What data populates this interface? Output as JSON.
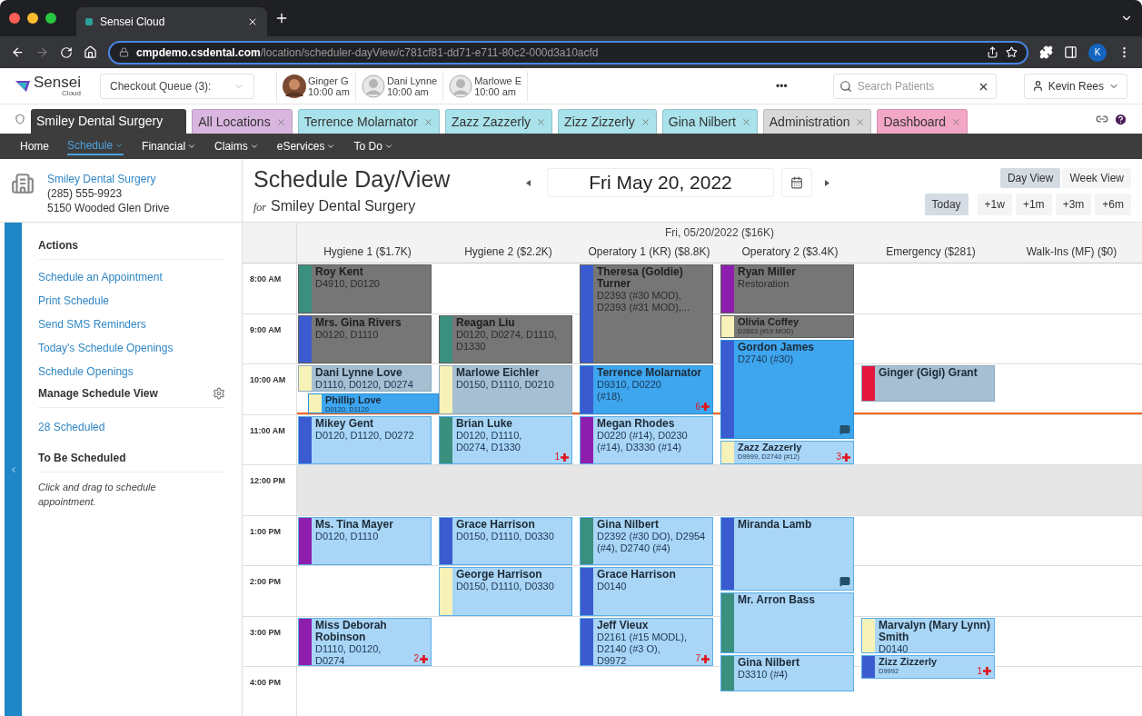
{
  "browser": {
    "tab_title": "Sensei Cloud",
    "url_host": "cmpdemo.csdental.com",
    "url_path": "/location/scheduler-dayView/c781cf81-dd71-e711-80c2-000d3a10acfd",
    "profile_initial": "K"
  },
  "app_header": {
    "logo": "Sensei",
    "logo_sub": "Cloud",
    "checkout_queue": "Checkout Queue (3):",
    "staff": [
      {
        "name": "Ginger G",
        "time": "10:00 am"
      },
      {
        "name": "Dani Lynne",
        "time": "10:00 am",
        "kind": "silhouette"
      },
      {
        "name": "Marlowe E",
        "time": "10:00 am",
        "kind": "silhouette"
      }
    ],
    "more": "•••",
    "search": {
      "placeholder": "Search Patients"
    },
    "user": "Kevin Rees"
  },
  "tabs": [
    {
      "label": "Smiley Dental Surgery",
      "color": "#3c3c3c",
      "closable": false,
      "selected": true
    },
    {
      "label": "All Locations",
      "color": "#d9b6e0",
      "closable": true,
      "selected": false
    },
    {
      "label": "Terrence Molarnator",
      "color": "#a9e2ea",
      "closable": true,
      "selected": false
    },
    {
      "label": "Zazz Zazzerly",
      "color": "#a9e2ea",
      "closable": true,
      "selected": false
    },
    {
      "label": "Zizz Zizzerly",
      "color": "#a9e2ea",
      "closable": true,
      "selected": false
    },
    {
      "label": "Gina Nilbert",
      "color": "#a9e2ea",
      "closable": true,
      "selected": false
    },
    {
      "label": "Administration",
      "color": "#d8d8d8",
      "closable": true,
      "selected": false
    },
    {
      "label": "Dashboard",
      "color": "#f3a7c6",
      "closable": true,
      "selected": false
    }
  ],
  "nav": [
    {
      "label": "Home",
      "dropdown": false,
      "selected": false
    },
    {
      "label": "Schedule",
      "dropdown": true,
      "selected": true
    },
    {
      "label": "Financial",
      "dropdown": true,
      "selected": false
    },
    {
      "label": "Claims",
      "dropdown": true,
      "selected": false
    },
    {
      "label": "eServices",
      "dropdown": true,
      "selected": false
    },
    {
      "label": "To Do",
      "dropdown": true,
      "selected": false
    }
  ],
  "sidebar": {
    "practice": {
      "name": "Smiley Dental Surgery",
      "phone": "(285) 555-9923",
      "address": "5150 Wooded Glen Drive"
    },
    "actions_title": "Actions",
    "actions": [
      "Schedule an Appointment",
      "Print Schedule",
      "Send SMS Reminders",
      "Today's Schedule Openings",
      "Schedule Openings"
    ],
    "manage_title": "Manage Schedule View",
    "scheduled_link": "28 Scheduled",
    "to_be_scheduled_title": "To Be Scheduled",
    "hint": "Click and drag to schedule appointment."
  },
  "schedule": {
    "title": "Schedule Day/View",
    "subtitle_prefix": "for",
    "subtitle": "Smiley Dental Surgery",
    "date": "Fri May 20, 2022",
    "view_buttons": [
      {
        "label": "Day View",
        "selected": true
      },
      {
        "label": "Week View",
        "selected": false
      }
    ],
    "jump_buttons": [
      {
        "label": "Today",
        "selected": true
      },
      {
        "label": "+1w",
        "selected": false
      },
      {
        "label": "+1m",
        "selected": false
      },
      {
        "label": "+3m",
        "selected": false
      },
      {
        "label": "+6m",
        "selected": false
      }
    ],
    "day_header": "Fri, 05/20/2022 ($16K)",
    "current_time_line": true,
    "times": [
      "8:00 AM",
      "9:00 AM",
      "10:00 AM",
      "11:00 AM",
      "12:00 PM",
      "1:00 PM",
      "2:00 PM",
      "3:00 PM",
      "4:00 PM"
    ],
    "columns": [
      {
        "name": "Hygiene 1 ($1.7K)",
        "appointments": [
          {
            "patient": "Roy Kent",
            "codes": "D4910, D0120",
            "color": "#3a8f7e",
            "kind": "completed"
          },
          {
            "patient": "Mrs. Gina Rivers",
            "codes": "D0120, D1110",
            "color": "#3b5bd1",
            "kind": "completed"
          },
          {
            "patient": "Dani Lynne Love",
            "codes": "D1110, D0120, D0274",
            "color": "#f7f2b8",
            "kind": "arrived"
          },
          {
            "patient": "Phillip Love",
            "codes": "D0120, D1120",
            "color": "#f7f2b8",
            "kind": "in_chair",
            "compact": true
          },
          {
            "patient": "Mikey Gent",
            "codes": "D0120, D1120, D0272",
            "color": "#3b5bd1",
            "kind": "scheduled"
          },
          {
            "patient": "Ms. Tina Mayer",
            "codes": "D0120, D1110",
            "color": "#8e1fae",
            "kind": "scheduled"
          },
          {
            "patient": "Miss Deborah Robinson",
            "codes": "D1110, D0120, D0274",
            "color": "#8e1fae",
            "kind": "scheduled",
            "badge": "2"
          }
        ]
      },
      {
        "name": "Hygiene 2 ($2.2K)",
        "appointments": [
          {
            "patient": "Reagan Liu",
            "codes": "D0120, D0274, D1110, D1330",
            "color": "#3a8f7e",
            "kind": "completed"
          },
          {
            "patient": "Marlowe Eichler",
            "codes": "D0150, D1110, D0210",
            "color": "#f7f2b8",
            "kind": "arrived"
          },
          {
            "patient": "Brian Luke",
            "codes": "D0120, D1110, D0274, D1330",
            "color": "#3a8f7e",
            "kind": "scheduled",
            "badge": "1"
          },
          {
            "patient": "Grace Harrison",
            "codes": "D0150, D1110, D0330",
            "color": "#3b5bd1",
            "kind": "scheduled"
          },
          {
            "patient": "George Harrison",
            "codes": "D0150, D1110, D0330",
            "color": "#f7f2b8",
            "kind": "scheduled"
          }
        ]
      },
      {
        "name": "Operatory 1 (KR) ($8.8K)",
        "appointments": [
          {
            "patient": "Theresa (Goldie) Turner",
            "codes": "D2393 (#30 MOD), D2393 (#31 MOD),...",
            "color": "#3b5bd1",
            "kind": "completed"
          },
          {
            "patient": "Terrence Molarnator",
            "codes": "D9310, D0220 (#18),",
            "color": "#3b5bd1",
            "kind": "in_chair",
            "badge": "6"
          },
          {
            "patient": "Megan Rhodes",
            "codes": "D0220 (#14), D0230 (#14), D3330 (#14)",
            "color": "#8e1fae",
            "kind": "scheduled"
          },
          {
            "patient": "Gina Nilbert",
            "codes": "D2392 (#30 DO), D2954 (#4), D2740 (#4)",
            "color": "#3a8f7e",
            "kind": "scheduled"
          },
          {
            "patient": "Grace Harrison",
            "codes": "D0140",
            "color": "#3b5bd1",
            "kind": "scheduled"
          },
          {
            "patient": "Jeff Vieux",
            "codes": "D2161 (#15 MODL), D2140 (#3 O), D9972",
            "color": "#3b5bd1",
            "kind": "scheduled",
            "badge": "7"
          }
        ]
      },
      {
        "name": "Operatory 2 ($3.4K)",
        "appointments": [
          {
            "patient": "Ryan Miller",
            "codes": "Restoration",
            "color": "#8e1fae",
            "kind": "completed"
          },
          {
            "patient": "Olivia Coffey",
            "codes": "D2663 (#19 MOD)",
            "color": "#f7f2b8",
            "kind": "completed",
            "compact": true
          },
          {
            "patient": "Gordon James",
            "codes": "D2740 (#30)",
            "color": "#3b5bd1",
            "kind": "in_chair",
            "note": true
          },
          {
            "patient": "Zazz Zazzerly",
            "codes": "D9999, D2740 (#12)",
            "color": "#f7f2b8",
            "kind": "scheduled",
            "compact": true,
            "badge": "3"
          },
          {
            "patient": "Miranda Lamb",
            "color": "#3b5bd1",
            "kind": "scheduled",
            "note": true
          },
          {
            "patient": "Mr. Arron Bass",
            "color": "#3a8f7e",
            "kind": "scheduled"
          },
          {
            "patient": "Gina Nilbert",
            "codes": "D3310 (#4)",
            "color": "#3a8f7e",
            "kind": "scheduled"
          }
        ]
      },
      {
        "name": "Emergency ($281)",
        "appointments": [
          {
            "patient": "Ginger (Gigi) Grant",
            "color": "#e3173e",
            "kind": "arrived"
          },
          {
            "patient": "Marvalyn (Mary Lynn) Smith",
            "codes": "D0140",
            "color": "#f7f2b8",
            "kind": "scheduled"
          },
          {
            "patient": "Zizz Zizzerly",
            "codes": "D9992",
            "color": "#3b5bd1",
            "kind": "scheduled",
            "compact": true,
            "badge": "1"
          }
        ]
      },
      {
        "name": "Walk-Ins (MF) ($0)"
      }
    ]
  }
}
